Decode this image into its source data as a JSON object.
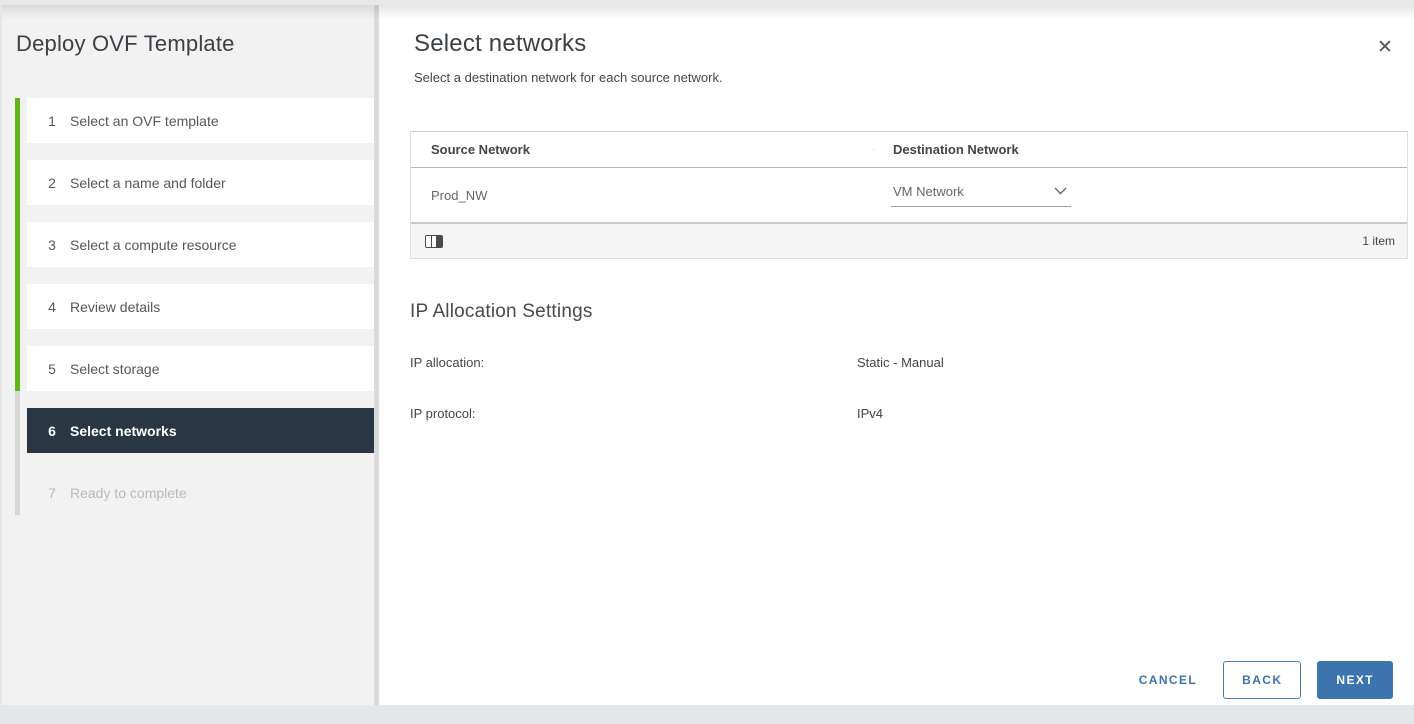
{
  "dialog": {
    "title": "Deploy OVF Template"
  },
  "sidebar": {
    "steps": [
      {
        "number": "1",
        "label": "Select an OVF template",
        "state": "done"
      },
      {
        "number": "2",
        "label": "Select a name and folder",
        "state": "done"
      },
      {
        "number": "3",
        "label": "Select a compute resource",
        "state": "done"
      },
      {
        "number": "4",
        "label": "Review details",
        "state": "done"
      },
      {
        "number": "5",
        "label": "Select storage",
        "state": "done"
      },
      {
        "number": "6",
        "label": "Select networks",
        "state": "active"
      },
      {
        "number": "7",
        "label": "Ready to complete",
        "state": "disabled"
      }
    ]
  },
  "main": {
    "heading": "Select networks",
    "subheading": "Select a destination network for each source network.",
    "table": {
      "columns": {
        "source": "Source Network",
        "destination": "Destination Network"
      },
      "rows": [
        {
          "source": "Prod_NW",
          "destination_selected": "VM Network"
        }
      ],
      "footer": {
        "count": "1 item"
      }
    },
    "ip_allocation": {
      "heading": "IP Allocation Settings",
      "rows": [
        {
          "label": "IP allocation:",
          "value": "Static - Manual"
        },
        {
          "label": "IP protocol:",
          "value": "IPv4"
        }
      ]
    },
    "buttons": {
      "cancel": "CANCEL",
      "back": "BACK",
      "next": "NEXT"
    }
  },
  "icons": {
    "close": "✕",
    "chevron_down": "chevron-down",
    "columns": "column-toggle"
  },
  "colors": {
    "progress_green": "#61b715",
    "active_step_bg": "#2a3642",
    "primary_blue": "#3d73af",
    "table_footer_bg": "#f5f5f5"
  }
}
